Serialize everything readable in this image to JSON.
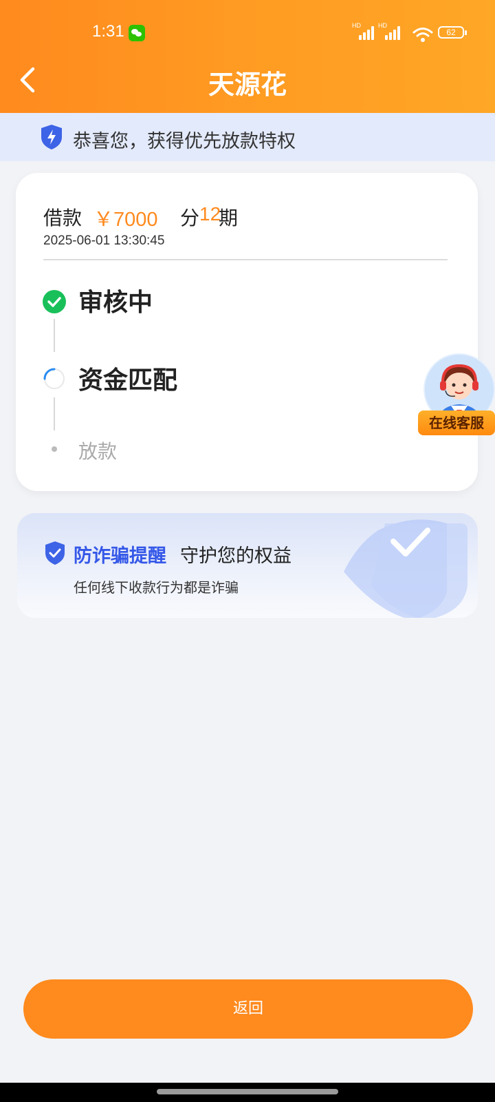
{
  "status_bar": {
    "time": "1:31",
    "signal_label_1": "HD",
    "signal_label_2": "HD",
    "battery": "62"
  },
  "header": {
    "title": "天源花"
  },
  "banner": {
    "text": "恭喜您，获得优先放款特权"
  },
  "loan": {
    "label": "借款",
    "amount": "￥7000",
    "period_prefix": "分",
    "period_count": "12",
    "period_suffix": "期",
    "date": "2025-06-01 13:30:45"
  },
  "steps": [
    {
      "label": "审核中",
      "status": "done"
    },
    {
      "label": "资金匹配",
      "status": "loading"
    },
    {
      "label": "放款",
      "status": "pending"
    }
  ],
  "customer_service": {
    "label": "在线客服"
  },
  "fraud_notice": {
    "title": "防诈骗提醒",
    "subtitle": "守护您的权益",
    "desc": "任何线下收款行为都是诈骗"
  },
  "footer": {
    "return_label": "返回"
  },
  "colors": {
    "brand_orange": "#ff8a1e",
    "success_green": "#19c05a",
    "notice_blue": "#3558e8"
  }
}
